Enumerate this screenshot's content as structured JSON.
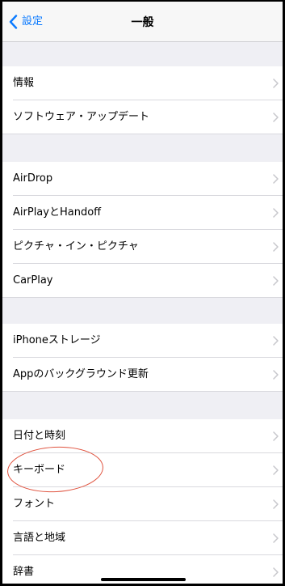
{
  "nav": {
    "back_label": "設定",
    "title": "一般"
  },
  "groups": [
    {
      "items": [
        "情報",
        "ソフトウェア・アップデート"
      ]
    },
    {
      "items": [
        "AirDrop",
        "AirPlayとHandoff",
        "ピクチャ・イン・ピクチャ",
        "CarPlay"
      ]
    },
    {
      "items": [
        "iPhoneストレージ",
        "Appのバックグラウンド更新"
      ]
    },
    {
      "items": [
        "日付と時刻",
        "キーボード",
        "フォント",
        "言語と地域",
        "辞書"
      ]
    }
  ],
  "annotation": {
    "highlighted_item": "キーボード",
    "color": "#e0533f"
  },
  "colors": {
    "accent": "#0a7aff",
    "chevron": "#c7c7cc",
    "group_bg": "#efeff4"
  },
  "icons": {
    "back": "chevron-left-icon",
    "row": "chevron-right-icon"
  }
}
